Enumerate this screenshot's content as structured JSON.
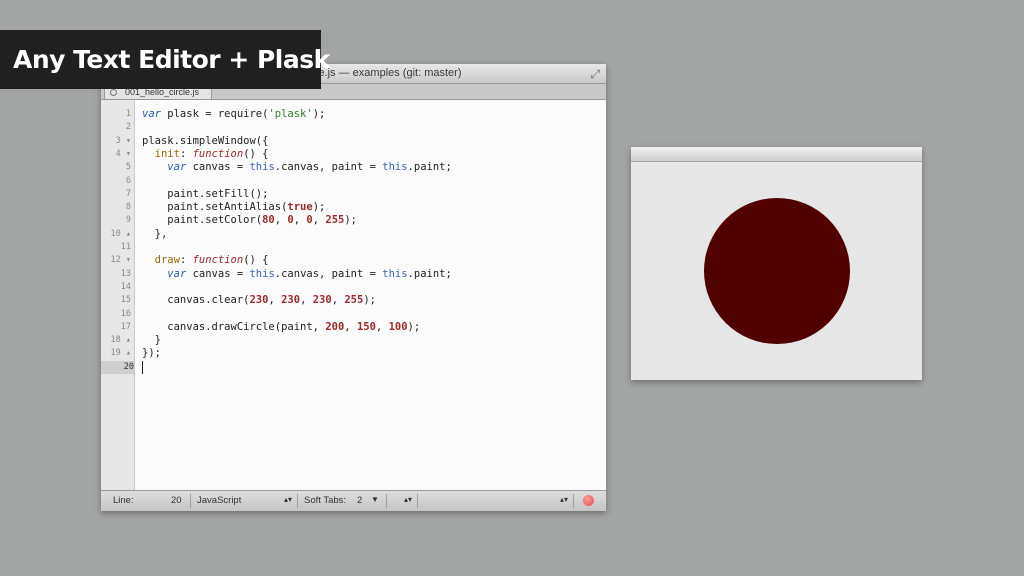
{
  "caption": "Any Text Editor + Plask",
  "editor": {
    "title": "le.js — examples (git: master)",
    "tab_label": "001_hello_circle.js",
    "lines": [
      {
        "n": "1",
        "fold": "",
        "html": "<span class=\"kw\">var</span> plask = require(<span class=\"str\">'plask'</span>);"
      },
      {
        "n": "2",
        "fold": "",
        "html": ""
      },
      {
        "n": "3",
        "fold": "▾",
        "html": "plask.simpleWindow({"
      },
      {
        "n": "4",
        "fold": "▾",
        "html": "  <span class=\"prop\">init</span>: <span class=\"fn\">function</span>() {"
      },
      {
        "n": "5",
        "fold": "",
        "html": "    <span class=\"kw\">var</span> canvas = <span class=\"this\">this</span>.canvas, paint = <span class=\"this\">this</span>.paint;"
      },
      {
        "n": "6",
        "fold": "",
        "html": ""
      },
      {
        "n": "7",
        "fold": "",
        "html": "    paint.setFill();"
      },
      {
        "n": "8",
        "fold": "",
        "html": "    paint.setAntiAlias(<span class=\"num\">true</span>);"
      },
      {
        "n": "9",
        "fold": "",
        "html": "    paint.setColor(<span class=\"num\">80</span>, <span class=\"num\">0</span>, <span class=\"num\">0</span>, <span class=\"num\">255</span>);"
      },
      {
        "n": "10",
        "fold": "▴",
        "html": "  },"
      },
      {
        "n": "11",
        "fold": "",
        "html": ""
      },
      {
        "n": "12",
        "fold": "▾",
        "html": "  <span class=\"prop\">draw</span>: <span class=\"fn\">function</span>() {"
      },
      {
        "n": "13",
        "fold": "",
        "html": "    <span class=\"kw\">var</span> canvas = <span class=\"this\">this</span>.canvas, paint = <span class=\"this\">this</span>.paint;"
      },
      {
        "n": "14",
        "fold": "",
        "html": ""
      },
      {
        "n": "15",
        "fold": "",
        "html": "    canvas.clear(<span class=\"num\">230</span>, <span class=\"num\">230</span>, <span class=\"num\">230</span>, <span class=\"num\">255</span>);"
      },
      {
        "n": "16",
        "fold": "",
        "html": ""
      },
      {
        "n": "17",
        "fold": "",
        "html": "    canvas.drawCircle(paint, <span class=\"num\">200</span>, <span class=\"num\">150</span>, <span class=\"num\">100</span>);"
      },
      {
        "n": "18",
        "fold": "▴",
        "html": "  }"
      },
      {
        "n": "19",
        "fold": "▴",
        "html": "});"
      },
      {
        "n": "20",
        "fold": "",
        "html": ""
      }
    ],
    "current_line": "20",
    "status": {
      "line_label": "Line:",
      "line_value": "20",
      "language": "JavaScript",
      "tabs_label": "Soft Tabs:",
      "tabs_value": "2"
    }
  },
  "plask": {
    "background": "#e6e6e6",
    "circle_color": "#500000"
  }
}
